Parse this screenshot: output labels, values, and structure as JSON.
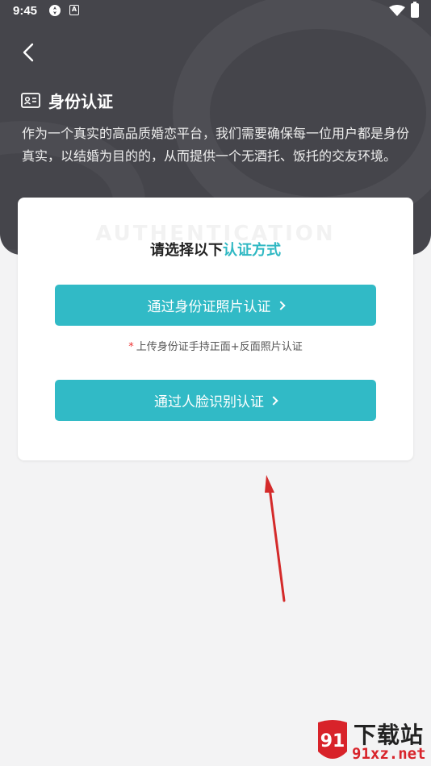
{
  "status_bar": {
    "time": "9:45",
    "notification_icon": "A"
  },
  "header": {
    "title": "身份认证",
    "description": "作为一个真实的高品质婚恋平台，我们需要确保每一位用户都是身份真实，以结婚为目的的，从而提供一个无酒托、饭托的交友环境。"
  },
  "card": {
    "watermark": "AUTHENTICATION",
    "heading_prefix": "请选择以下",
    "heading_accent": "认证方式",
    "id_photo_button": "通过身份证照片认证",
    "note_star": "*",
    "note": "上传身份证手持正面+反面照片认证",
    "face_button": "通过人脸识别认证"
  },
  "logo": {
    "name": "下载站",
    "url": "91xz.net",
    "badge": "91"
  },
  "colors": {
    "accent": "#31bac6",
    "header_bg": "#45454b",
    "page_bg": "#f3f3f4"
  }
}
